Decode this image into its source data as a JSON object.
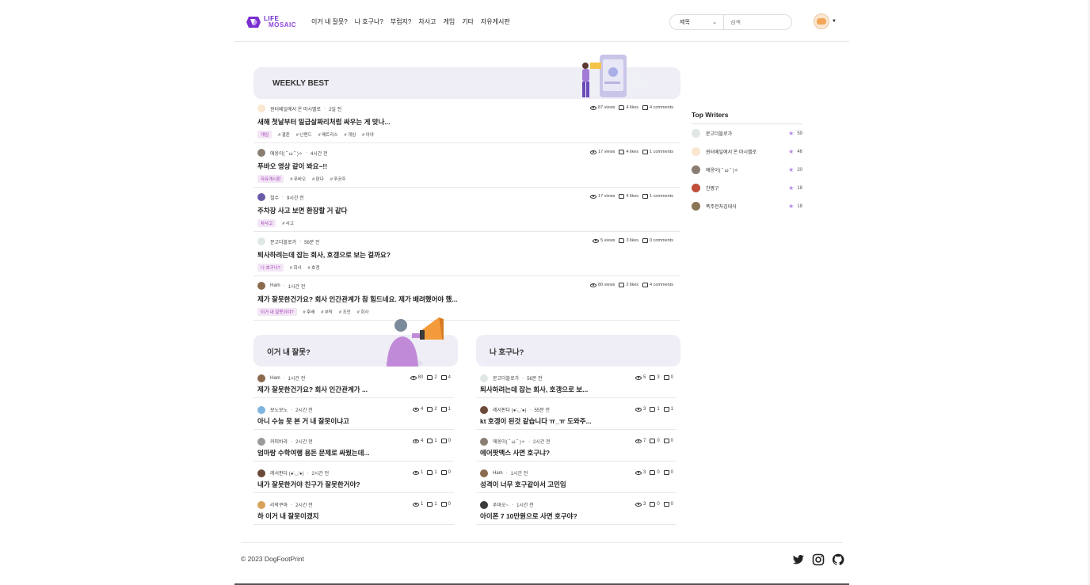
{
  "header": {
    "logo_line1": "LIFE",
    "logo_line2": "MOSAIC",
    "nav": [
      "이거 내 잘못?",
      "나 호구나?",
      "부럽지?",
      "차사고",
      "게임",
      "기타",
      "자유게시판"
    ],
    "search_select": "제목",
    "search_placeholder": "검색"
  },
  "weekly": {
    "title": "WEEKLY BEST",
    "posts": [
      {
        "author": "윈터베일에서 온 마시멜로",
        "time": "2일 전",
        "title": "새해 첫날부터 일급살짜리처럼 싸우는 게 맞나...",
        "category": "게임",
        "tags": [
          "# 결혼",
          "# 난맨드",
          "# 메트리스",
          "# 게임",
          "# 아야"
        ],
        "views": "87 views",
        "likes": "4 likes",
        "comments": "4 comments",
        "avatar_color": "#fbe6cf"
      },
      {
        "author": "애옹이( ˘ ω ˘ )✧",
        "time": "4시간 전",
        "title": "푸바오 영상 같이 봐요~!!",
        "category": "자유게시판",
        "tags": [
          "# 푸바오",
          "# 판다",
          "# 푸공주"
        ],
        "views": "17 views",
        "likes": "4 likes",
        "comments": "1 comments",
        "avatar_color": "#8a7d72"
      },
      {
        "author": "철수",
        "time": "9시간 전",
        "title": "주차장 사고 보면 환장할 거 같다",
        "category": "차사고",
        "tags": [
          "# 사고"
        ],
        "views": "17 views",
        "likes": "4 likes",
        "comments": "1 comments",
        "avatar_color": "#6a5aa8"
      },
      {
        "author": "문고더블로가",
        "time": "56분 전",
        "title": "퇴사하려는데 잡는 회사, 호갱으로 보는 걸까요?",
        "category": "나 호구나?",
        "tags": [
          "# 회사",
          "# 호갱"
        ],
        "views": "5 views",
        "likes": "3 likes",
        "comments": "0 comments",
        "avatar_color": "#dfe8e4"
      },
      {
        "author": "Ham",
        "time": "1시간 전",
        "title": "제가 잘못한건가요? 회사 인간관계가 참 힘드네요. 제가 배려했어야 했...",
        "category": "이거 내 잘못이야?",
        "tags": [
          "# 후배",
          "# 부탁",
          "# 조언",
          "# 회사"
        ],
        "views": "80 views",
        "likes": "2 likes",
        "comments": "4 comments",
        "avatar_color": "#8b6a4e"
      }
    ]
  },
  "top_writers": {
    "title": "Top Writers",
    "writers": [
      {
        "name": "문고더블로가",
        "score": "59",
        "avatar_color": "#dfe8e4"
      },
      {
        "name": "윈터베일에서 온 마시멜로",
        "score": "46",
        "avatar_color": "#fbe6cf"
      },
      {
        "name": "애옹이( ˘ ω ˘ )✧",
        "score": "20",
        "avatar_color": "#8a7d72"
      },
      {
        "name": "찬쨩구",
        "score": "18",
        "avatar_color": "#c0503a"
      },
      {
        "name": "폭주전자김대식",
        "score": "18",
        "avatar_color": "#8a7555"
      }
    ]
  },
  "board_left": {
    "title": "이거 내 잘못?",
    "posts": [
      {
        "author": "Ham",
        "time": "1시간 전",
        "title": "제가 잘못한건가요? 회사 인간관계가 ...",
        "views": "80",
        "likes": "2",
        "comments": "4",
        "avatar_color": "#8b6a4e"
      },
      {
        "author": "보노보노",
        "time": "2시간 전",
        "title": "아니 수능 못 본 거 내 잘못이냐고",
        "views": "4",
        "likes": "2",
        "comments": "1",
        "avatar_color": "#7fb6e0"
      },
      {
        "author": "커피바라",
        "time": "2시간 전",
        "title": "엄마랑 수학여행 용돈 문제로 싸웠는데...",
        "views": "4",
        "likes": "1",
        "comments": "0",
        "avatar_color": "#9a9a9a"
      },
      {
        "author": "레서판다 (●'◡'●)",
        "time": "2시간 전",
        "title": "내가 잘못한거야 친구가 잘못한거야?",
        "views": "1",
        "likes": "1",
        "comments": "0",
        "avatar_color": "#6b4a3a"
      },
      {
        "author": "리락쿠마",
        "time": "2시간 전",
        "title": "하 이거 내 잘못이겠지",
        "views": "1",
        "likes": "1",
        "comments": "0",
        "avatar_color": "#d9a25b"
      }
    ]
  },
  "board_right": {
    "title": "나 호구나?",
    "posts": [
      {
        "author": "문고더블로가",
        "time": "56분 전",
        "title": "퇴사하려는데 잡는 회사, 호갱으로 보...",
        "views": "5",
        "likes": "3",
        "comments": "0",
        "avatar_color": "#dfe8e4"
      },
      {
        "author": "레서판다 (●'◡'●)",
        "time": "55분 전",
        "title": "kt 호갱이 된것 같습니다 ㅠ_ㅠ 도와주...",
        "views": "3",
        "likes": "1",
        "comments": "1",
        "avatar_color": "#6b4a3a"
      },
      {
        "author": "애옹이( ˘ ω ˘ )✧",
        "time": "2시간 전",
        "title": "에어팟맥스 사면 호구냐?",
        "views": "7",
        "likes": "0",
        "comments": "0",
        "avatar_color": "#8a7d72"
      },
      {
        "author": "Ham",
        "time": "1시간 전",
        "title": "성격이 너무 호구같아서 고민임",
        "views": "3",
        "likes": "0",
        "comments": "0",
        "avatar_color": "#8b6a4e"
      },
      {
        "author": "푸바오~",
        "time": "1시간 전",
        "title": "아이폰 7 10만원으로 사면 호구야?",
        "views": "3",
        "likes": "0",
        "comments": "0",
        "avatar_color": "#3b3b3b"
      }
    ]
  },
  "footer": {
    "copyright": "© 2023 DogFootPrint",
    "social_icons": [
      "twitter-icon",
      "instagram-icon",
      "github-icon"
    ]
  }
}
